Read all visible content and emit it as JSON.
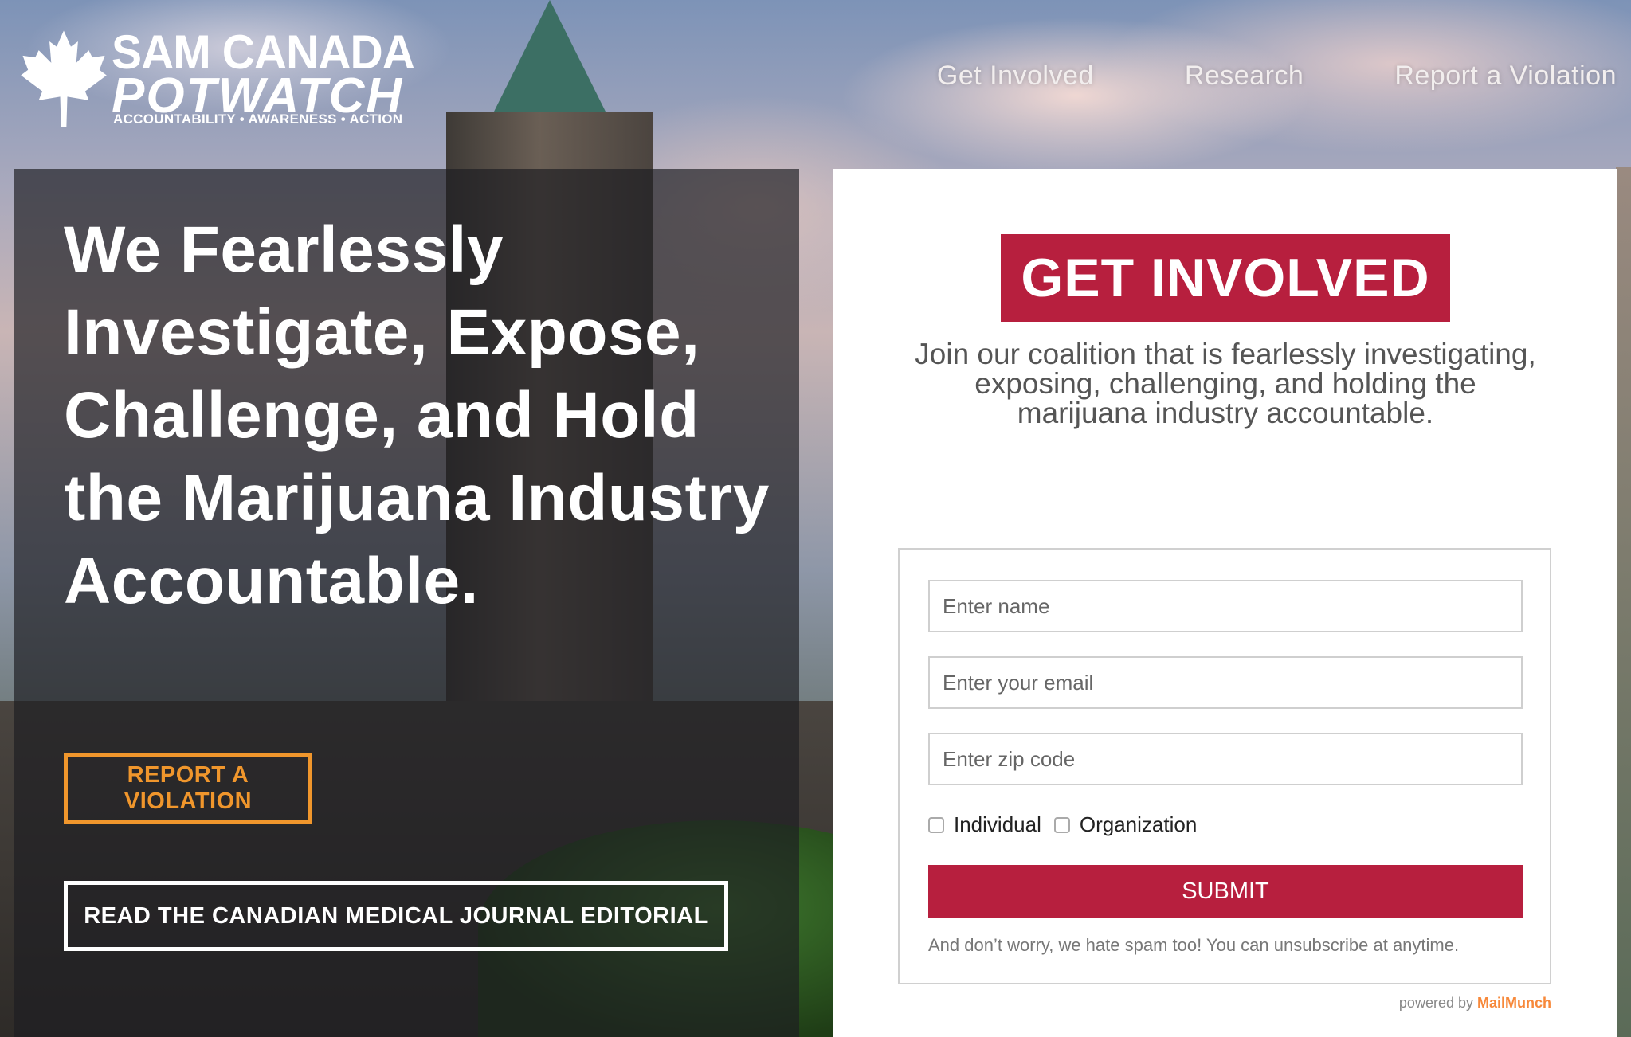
{
  "header": {
    "logo": {
      "line1": "SAM CANADA",
      "line2": "POTWATCH",
      "tagline": "ACCOUNTABILITY  •  AWARENESS  •  ACTION",
      "icon": "maple-leaf-icon"
    },
    "nav": [
      {
        "label": "Get Involved"
      },
      {
        "label": "Research"
      },
      {
        "label": "Report a Violation"
      }
    ]
  },
  "hero": {
    "title": "We Fearlessly Investigate, Expose, Challenge, and Hold the Marijuana Industry Accountable.",
    "report_button": "REPORT A VIOLATION",
    "editorial_button": "READ THE CANADIAN MEDICAL JOURNAL EDITORIAL"
  },
  "signup": {
    "badge": "GET INVOLVED",
    "description": "Join our coalition that is fearlessly investigating, exposing, challenging, and holding the marijuana industry accountable.",
    "fields": {
      "name_placeholder": "Enter name",
      "email_placeholder": "Enter your email",
      "zip_placeholder": "Enter zip code"
    },
    "checkboxes": [
      {
        "label": "Individual",
        "checked": false
      },
      {
        "label": "Organization",
        "checked": false
      }
    ],
    "submit_label": "SUBMIT",
    "spam_note": "And don’t worry, we hate spam too! You can unsubscribe at anytime.",
    "powered_prefix": "powered by",
    "powered_brand": "MailMunch"
  },
  "colors": {
    "accent_red": "#b71f3e",
    "violation_orange": "#f0962c",
    "brand_orange": "#f7893b"
  }
}
